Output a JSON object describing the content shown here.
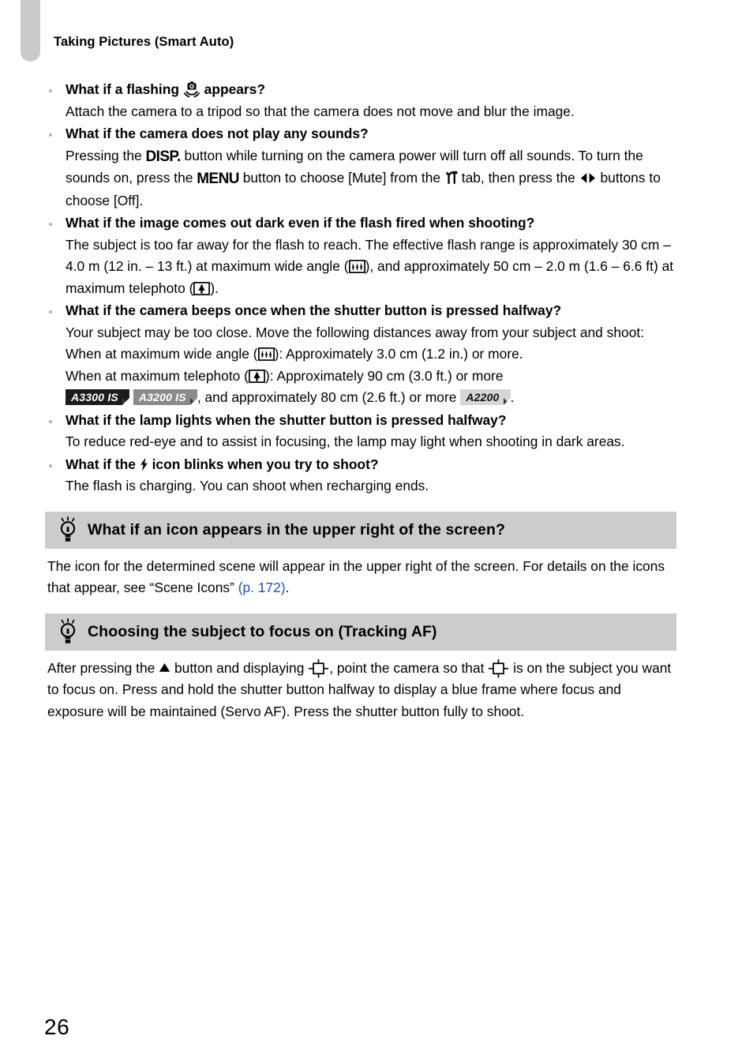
{
  "page": {
    "running_head": "Taking Pictures (Smart Auto)",
    "folio": "26"
  },
  "faq": [
    {
      "q_before": "What if a flashing",
      "q_icon": "camera-shake-icon",
      "q_after": "appears?",
      "answer": "Attach the camera to a tripod so that the camera does not move and blur the image."
    },
    {
      "q": "What if the camera does not play any sounds?",
      "a1": "Pressing the",
      "btn1": "DISP.",
      "a2": "button while turning on the camera power will turn off all sounds. To turn the sounds on, press the",
      "btn2": "MENU",
      "a3": "button to choose [Mute] from the",
      "a4": "tab, then press the",
      "a5": "buttons to choose [Off]."
    },
    {
      "q": "What if the image comes out dark even if the flash fired when shooting?",
      "a1": "The subject is too far away for the flash to reach. The effective flash range is approximately 30 cm – 4.0 m (12 in. – 13 ft.) at maximum wide angle (",
      "a2": "), and approximately 50 cm – 2.0 m (1.6 – 6.6 ft) at maximum telephoto (",
      "a3": ")."
    },
    {
      "q": "What if the camera beeps once when the shutter button is pressed halfway?",
      "a1": "Your subject may be too close. Move the following distances away from your subject and shoot:",
      "a2": "When at maximum wide angle (",
      "a3": "): Approximately 3.0 cm (1.2 in.) or more.",
      "a4": "When at maximum telephoto (",
      "a5": "): Approximately 90 cm (3.0 ft.) or more",
      "a6": ", and approximately 80 cm (2.6 ft.) or more",
      "a7": "."
    },
    {
      "q": "What if the lamp lights when the shutter button is pressed halfway?",
      "answer": "To reduce red-eye and to assist in focusing, the lamp may light when shooting in dark areas."
    },
    {
      "q_before": "What if the",
      "q_icon": "flash-bolt-icon",
      "q_after": "icon blinks when you try to shoot?",
      "answer": "The flash is charging. You can shoot when recharging ends."
    }
  ],
  "badges": [
    {
      "label": "A3300 IS",
      "style": "dark"
    },
    {
      "label": "A3200 IS",
      "style": "mid"
    },
    {
      "label": "A2200",
      "style": "light"
    }
  ],
  "tips": [
    {
      "title": "What if an icon appears in the upper right of the screen?",
      "body_1": "The icon for the determined scene will appear in the upper right of the screen. For details on the icons that appear, see “Scene Icons”",
      "link": "(p. 172)",
      "body_2": "."
    },
    {
      "title": "Choosing the subject to focus on (Tracking AF)",
      "t1": "After pressing the",
      "t2": "button and displaying",
      "t3": ", point the camera so that",
      "t4": "is on the subject you want to focus on. Press and hold the shutter button halfway to display a blue frame where focus and exposure will be maintained (Servo AF). Press the shutter button fully to shoot."
    }
  ],
  "colors": {
    "tab_gray": "#c9c9c9",
    "tip_header_gray": "#cccccc",
    "link_blue": "#1f49d6",
    "badge_dark": "#1c1c1c",
    "badge_mid": "#8a8a8a",
    "badge_light": "#d6d6d6"
  }
}
